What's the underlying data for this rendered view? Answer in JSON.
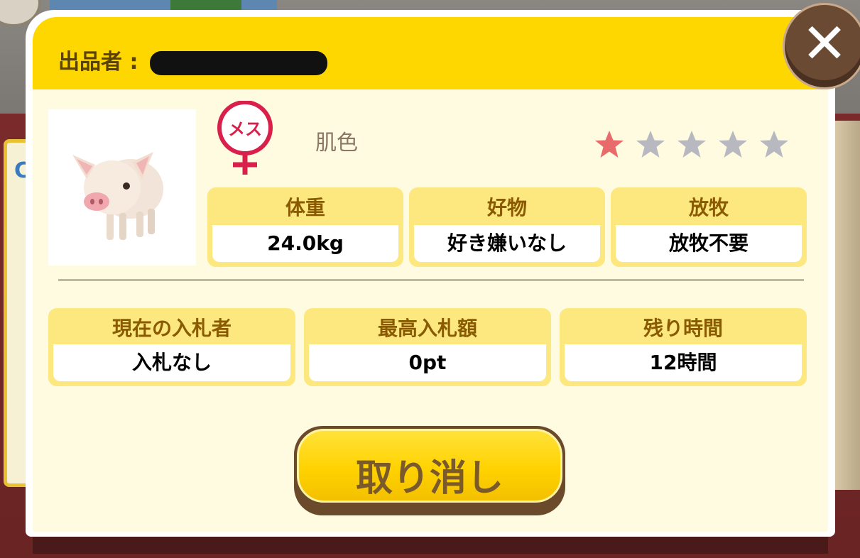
{
  "header": {
    "seller_label": "出品者 : "
  },
  "close_icon": "close-icon",
  "animal": {
    "gender_icon": "female-icon",
    "gender_label": "メス",
    "skin_label": "肌色",
    "rating": {
      "filled": 1,
      "total": 5,
      "filled_color": "#e86a6a",
      "empty_color": "#b8b8c0"
    }
  },
  "stats": [
    {
      "label": "体重",
      "value": "24.0kg"
    },
    {
      "label": "好物",
      "value": "好き嫌いなし"
    },
    {
      "label": "放牧",
      "value": "放牧不要"
    }
  ],
  "auction": [
    {
      "label": "現在の入札者",
      "value": "入札なし"
    },
    {
      "label": "最高入札額",
      "value": "0pt"
    },
    {
      "label": "残り時間",
      "value": "12時間"
    }
  ],
  "cancel_button": {
    "label": "取り消し"
  },
  "colors": {
    "accent": "#fed600",
    "panel": "#fffbe0",
    "label_text": "#8a5a00"
  }
}
